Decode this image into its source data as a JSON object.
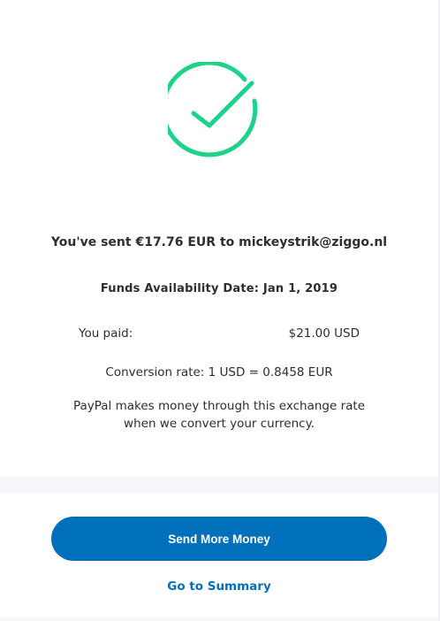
{
  "confirmation": {
    "sent_message": "You've sent €17.76 EUR to mickeystrik@ziggo.nl",
    "funds_availability": "Funds Availability Date: Jan 1, 2019",
    "paid_label": "You paid:",
    "paid_amount": "$21.00 USD",
    "conversion_rate": "Conversion rate: 1 USD = 0.8458 EUR",
    "disclaimer": "PayPal makes money through this exchange rate when we convert your currency."
  },
  "actions": {
    "send_more_label": "Send More Money",
    "summary_label": "Go to Summary"
  },
  "colors": {
    "success_green": "#1ed28a",
    "primary_blue": "#0070ba",
    "text_dark": "#2c2e2f",
    "band_grey": "#f5f7fa"
  },
  "icons": {
    "status": "success-check-icon"
  }
}
